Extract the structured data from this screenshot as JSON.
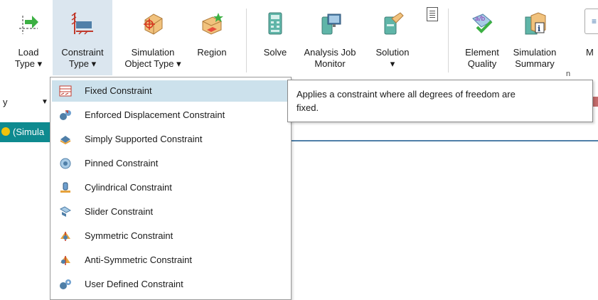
{
  "ribbon": {
    "buttons": [
      {
        "id": "load-type",
        "lines": [
          "Load",
          "Type ▾"
        ]
      },
      {
        "id": "constraint-type",
        "lines": [
          "Constraint",
          "Type ▾"
        ]
      },
      {
        "id": "simulation-object-type",
        "lines": [
          "Simulation",
          "Object Type ▾"
        ]
      },
      {
        "id": "region",
        "lines": [
          "Region"
        ]
      },
      {
        "id": "solve",
        "lines": [
          "Solve"
        ]
      },
      {
        "id": "analysis-job-monitor",
        "lines": [
          "Analysis Job",
          "Monitor"
        ]
      },
      {
        "id": "solution",
        "lines": [
          "Solution",
          "▾"
        ]
      },
      {
        "id": "element-quality",
        "lines": [
          "Element",
          "Quality"
        ]
      },
      {
        "id": "simulation-summary",
        "lines": [
          "Simulation",
          "Summary"
        ]
      },
      {
        "id": "more",
        "lines": [
          "M"
        ]
      }
    ],
    "section_label_fragment": "n"
  },
  "left_panel": {
    "combo_text": "y",
    "tree_item": "(Simula"
  },
  "menu": {
    "items": [
      {
        "label": "Fixed Constraint",
        "icon": "fixed-constraint-icon",
        "highlighted": true
      },
      {
        "label": "Enforced Displacement Constraint",
        "icon": "enforced-displacement-icon"
      },
      {
        "label": "Simply Supported Constraint",
        "icon": "simply-supported-icon"
      },
      {
        "label": "Pinned Constraint",
        "icon": "pinned-icon"
      },
      {
        "label": "Cylindrical Constraint",
        "icon": "cylindrical-icon"
      },
      {
        "label": "Slider Constraint",
        "icon": "slider-icon"
      },
      {
        "label": "Symmetric Constraint",
        "icon": "symmetric-icon"
      },
      {
        "label": "Anti-Symmetric Constraint",
        "icon": "anti-symmetric-icon"
      },
      {
        "label": "User Defined Constraint",
        "icon": "user-defined-icon"
      }
    ]
  },
  "tooltip": {
    "line1": "Applies a constraint where all degrees of freedom are",
    "line2": "fixed."
  },
  "colors": {
    "accent_teal": "#0e8a8f",
    "menu_highlight": "#cce1ec",
    "button_active": "#dbe6ef"
  }
}
